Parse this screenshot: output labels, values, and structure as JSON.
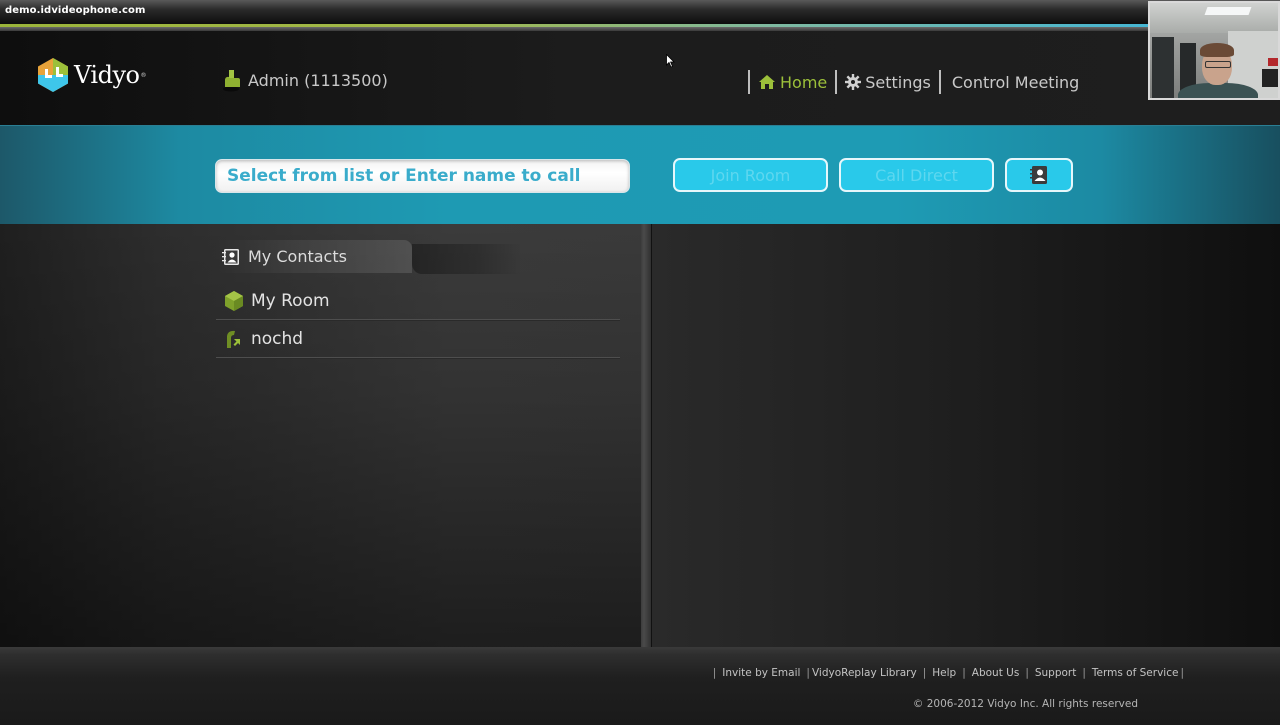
{
  "browser": {
    "url": "demo.idvideophone.com"
  },
  "header": {
    "logo_text": "Vidyo",
    "logo_mark": "®",
    "user_label": "Admin (1113500)",
    "nav": [
      {
        "label": "Home",
        "icon": "home-icon",
        "active": true
      },
      {
        "label": "Settings",
        "icon": "gear-icon",
        "active": false
      },
      {
        "label": "Control Meeting",
        "icon": null,
        "active": false
      }
    ]
  },
  "callbar": {
    "search_placeholder": "Select from list or Enter name to call",
    "search_value": "",
    "join_room_label": "Join Room",
    "call_direct_label": "Call Direct",
    "contacts_icon": "address-book-icon"
  },
  "contacts": {
    "tab_label": "My Contacts",
    "items": [
      {
        "name": "My Room",
        "icon": "room-cube-icon"
      },
      {
        "name": "nochd",
        "icon": "user-status-icon"
      }
    ]
  },
  "footer": {
    "links": [
      "Invite by Email",
      "VidyoReplay Library",
      "Help",
      "About Us",
      "Support",
      "Terms of Service"
    ],
    "copyright": "© 2006-2012 Vidyo Inc. All rights reserved"
  },
  "colors": {
    "accent_green": "#9cc03a",
    "callbar_teal": "#1e9bb4",
    "button_cyan": "#29c9ea",
    "search_text": "#36aac9"
  }
}
